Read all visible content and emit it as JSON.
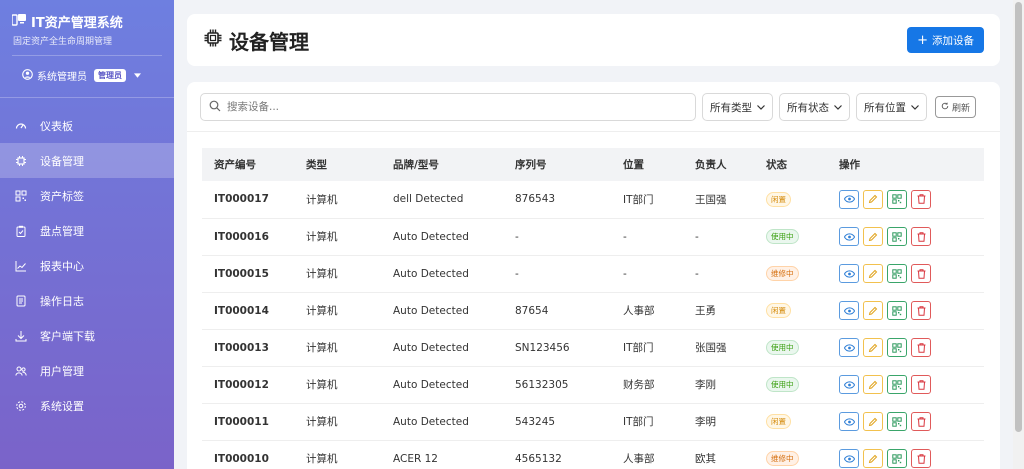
{
  "app": {
    "title": "IT资产管理系统",
    "subtitle": "固定资产全生命周期管理"
  },
  "user": {
    "name": "系统管理员",
    "role": "管理员"
  },
  "sidebar": {
    "items": [
      {
        "label": "仪表板",
        "icon": "dashboard-icon"
      },
      {
        "label": "设备管理",
        "icon": "chip-icon",
        "active": true
      },
      {
        "label": "资产标签",
        "icon": "qr-icon"
      },
      {
        "label": "盘点管理",
        "icon": "clipboard-icon"
      },
      {
        "label": "报表中心",
        "icon": "chart-icon"
      },
      {
        "label": "操作日志",
        "icon": "log-icon"
      },
      {
        "label": "客户端下载",
        "icon": "download-icon"
      },
      {
        "label": "用户管理",
        "icon": "users-icon"
      },
      {
        "label": "系统设置",
        "icon": "gear-icon"
      }
    ]
  },
  "header": {
    "title": "设备管理",
    "add_label": "添加设备"
  },
  "filters": {
    "search_placeholder": "搜索设备...",
    "type": "所有类型",
    "status": "所有状态",
    "location": "所有位置",
    "refresh": "刷新"
  },
  "table": {
    "headers": [
      "资产编号",
      "类型",
      "品牌/型号",
      "序列号",
      "位置",
      "负责人",
      "状态",
      "操作"
    ],
    "rows": [
      {
        "asset": "IT000017",
        "type": "计算机",
        "model": "dell Detected",
        "serial": "876543",
        "location": "IT部门",
        "owner": "王国强",
        "status": "闲置"
      },
      {
        "asset": "IT000016",
        "type": "计算机",
        "model": "Auto Detected",
        "serial": "-",
        "location": "-",
        "owner": "-",
        "status": "使用中"
      },
      {
        "asset": "IT000015",
        "type": "计算机",
        "model": "Auto Detected",
        "serial": "-",
        "location": "-",
        "owner": "-",
        "status": "维修中"
      },
      {
        "asset": "IT000014",
        "type": "计算机",
        "model": "Auto Detected",
        "serial": "87654",
        "location": "人事部",
        "owner": "王勇",
        "status": "闲置"
      },
      {
        "asset": "IT000013",
        "type": "计算机",
        "model": "Auto Detected",
        "serial": "SN123456",
        "location": "IT部门",
        "owner": "张国强",
        "status": "使用中"
      },
      {
        "asset": "IT000012",
        "type": "计算机",
        "model": "Auto Detected",
        "serial": "56132305",
        "location": "财务部",
        "owner": "李刚",
        "status": "使用中"
      },
      {
        "asset": "IT000011",
        "type": "计算机",
        "model": "Auto Detected",
        "serial": "543245",
        "location": "IT部门",
        "owner": "李明",
        "status": "闲置"
      },
      {
        "asset": "IT000010",
        "type": "计算机",
        "model": "ACER 12",
        "serial": "4565132",
        "location": "人事部",
        "owner": "欧其",
        "status": "维修中"
      }
    ]
  },
  "colors": {
    "sidebar_top": "#6e7fe0",
    "sidebar_bottom": "#7a63c9",
    "primary": "#1677e6"
  }
}
